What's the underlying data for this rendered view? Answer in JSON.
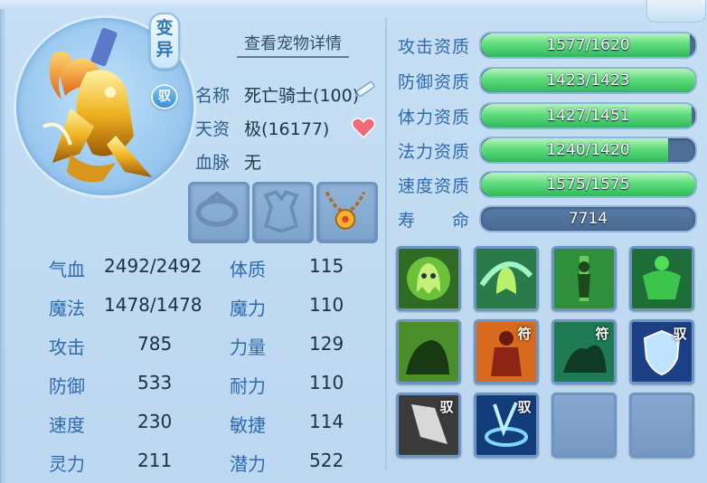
{
  "header": {
    "variant_badge": "变异",
    "ride_badge": "驭",
    "detail_link": "查看宠物详情"
  },
  "pet": {
    "name_label": "名称",
    "name_value": "死亡骑士(100)",
    "aptitude_label": "天资",
    "aptitude_value": "极(16177)",
    "bloodline_label": "血脉",
    "bloodline_value": "无"
  },
  "stats_left": [
    {
      "label": "气血",
      "value": "2492/2492"
    },
    {
      "label": "魔法",
      "value": "1478/1478"
    },
    {
      "label": "攻击",
      "value": "785"
    },
    {
      "label": "防御",
      "value": "533"
    },
    {
      "label": "速度",
      "value": "230"
    },
    {
      "label": "灵力",
      "value": "211"
    }
  ],
  "stats_right": [
    {
      "label": "体质",
      "value": "115"
    },
    {
      "label": "魔力",
      "value": "110"
    },
    {
      "label": "力量",
      "value": "129"
    },
    {
      "label": "耐力",
      "value": "110"
    },
    {
      "label": "敏捷",
      "value": "114"
    },
    {
      "label": "潜力",
      "value": "522"
    }
  ],
  "aptitudes": [
    {
      "label": "攻击资质",
      "text": "1577/1620",
      "fill": 0.9735
    },
    {
      "label": "防御资质",
      "text": "1423/1423",
      "fill": 1.0
    },
    {
      "label": "体力资质",
      "text": "1427/1451",
      "fill": 0.9835
    },
    {
      "label": "法力资质",
      "text": "1240/1420",
      "fill": 0.8732
    },
    {
      "label": "速度资质",
      "text": "1575/1575",
      "fill": 1.0
    },
    {
      "label": "寿　　命",
      "text": "7714",
      "fill": 0
    }
  ],
  "skill_tags": {
    "fu": "符",
    "yu": "驭"
  },
  "colors": {
    "accent": "#2d6ab0",
    "bar_fill": "#4fd274",
    "bar_bg": "#4f6f98"
  }
}
